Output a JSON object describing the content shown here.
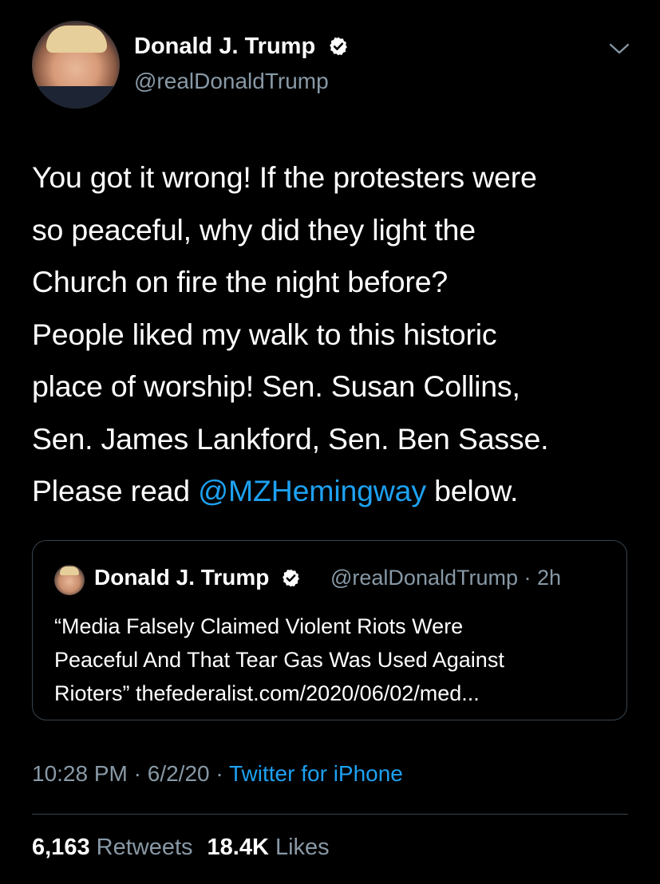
{
  "author": {
    "name": "Donald J. Trump",
    "handle": "@realDonaldTrump",
    "verified_icon": "verified-badge-icon"
  },
  "tweet": {
    "lines": [
      "You got it wrong! If the protesters were",
      "so peaceful, why did they light the",
      "Church on fire the night before?",
      "People liked my walk to this historic",
      "place of worship! Sen. Susan Collins,",
      "Sen. James Lankford, Sen. Ben Sasse."
    ],
    "last_line_prefix": "Please read ",
    "mention": "@MZHemingway",
    "last_line_suffix": " below."
  },
  "quoted_tweet": {
    "name": "Donald J. Trump",
    "handle": "@realDonaldTrump",
    "separator": "·",
    "time": "2h",
    "lines": [
      "“Media Falsely Claimed Violent Riots Were",
      "Peaceful And That Tear Gas Was Used Against",
      "Rioters” thefederalist.com/2020/06/02/med..."
    ]
  },
  "meta": {
    "time": "10:28 PM",
    "separator": "·",
    "date": "6/2/20",
    "source": "Twitter for iPhone"
  },
  "stats": {
    "retweets_count": "6,163",
    "retweets_label": "Retweets",
    "likes_count": "18.4K",
    "likes_label": "Likes"
  },
  "colors": {
    "background": "#000000",
    "text": "#ffffff",
    "secondary": "#8899a6",
    "link": "#1da1f2",
    "border": "#38444d"
  }
}
